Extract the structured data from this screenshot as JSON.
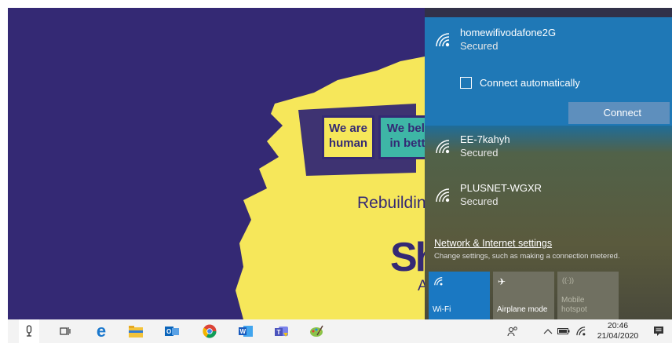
{
  "wallpaper": {
    "card1": [
      "We are",
      "human"
    ],
    "card2": [
      "We beli",
      "in bett"
    ],
    "tagline": "Rebuilding",
    "logo": "Sh",
    "logo_sub": "As"
  },
  "flyout": {
    "networks": [
      {
        "name": "homewifivodafone2G",
        "status": "Secured",
        "icon": "wifi-icon"
      },
      {
        "name": "EE-7kahyh",
        "status": "Secured",
        "icon": "wifi-icon"
      },
      {
        "name": "PLUSNET-WGXR",
        "status": "Secured",
        "icon": "wifi-icon"
      }
    ],
    "connect_auto_label": "Connect automatically",
    "connect_button": "Connect",
    "settings_link": "Network & Internet settings",
    "settings_desc": "Change settings, such as making a connection metered.",
    "tiles": [
      {
        "label": "Wi-Fi",
        "icon": "wifi-icon"
      },
      {
        "label": "Airplane mode",
        "icon": "airplane-icon"
      },
      {
        "label_line1": "Mobile",
        "label_line2": "hotspot",
        "icon": "hotspot-icon"
      }
    ]
  },
  "taskbar": {
    "time": "20:46",
    "date": "21/04/2020"
  },
  "colors": {
    "wallpaper_bg": "#342974",
    "accent": "#1a78c2",
    "yellow": "#f6e75a"
  }
}
